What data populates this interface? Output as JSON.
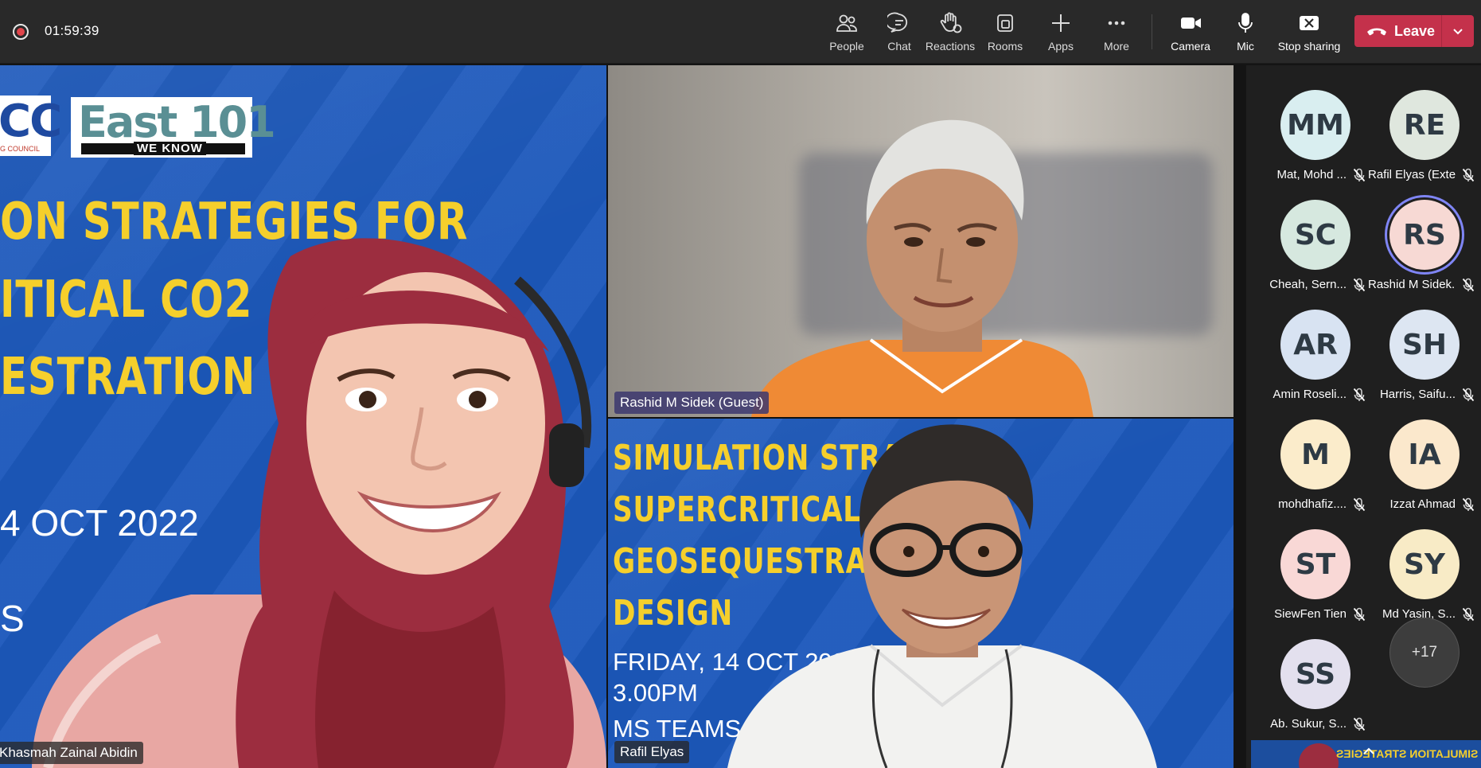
{
  "meeting": {
    "elapsed_time": "01:59:39"
  },
  "toolbar": {
    "people_label": "People",
    "chat_label": "Chat",
    "reactions_label": "Reactions",
    "rooms_label": "Rooms",
    "apps_label": "Apps",
    "more_label": "More",
    "camera_label": "Camera",
    "mic_label": "Mic",
    "stop_sharing_label": "Stop sharing",
    "leave_label": "Leave"
  },
  "video_tiles": [
    {
      "name_tag": "Khasmah Zainal Abidin",
      "slide": {
        "logo_left": "CC",
        "logo_left_small": "G COUNCIL",
        "logo_main": "East 101",
        "logo_sub": "WE KNOW",
        "line1": "ON STRATEGIES FOR",
        "line2": "ITICAL CO2",
        "line3": "ESTRATION COMP",
        "date": "4 OCT 2022",
        "platform": "S"
      }
    },
    {
      "name_tag": "Rashid M Sidek (Guest)"
    },
    {
      "name_tag": "Rafil Elyas",
      "slide": {
        "line1": "SIMULATION STRATEG",
        "line2": "SUPERCRITICAL CO2",
        "line3": "GEOSEQUESTRATION C",
        "line4": "DESIGN",
        "date": "FRIDAY, 14 OCT 2022",
        "time": "3.00PM",
        "platform": "MS TEAMS"
      }
    }
  ],
  "participants": [
    {
      "initials": "MM",
      "name": "Mat, Mohd ...",
      "color": "#d9eef0"
    },
    {
      "initials": "RE",
      "name": "Rafil Elyas (Exte...",
      "color": "#dfe7de"
    },
    {
      "initials": "SC",
      "name": "Cheah, Sern...",
      "color": "#d6e8df"
    },
    {
      "initials": "RS",
      "name": "Rashid M Sidek...",
      "color": "#f7d9d4"
    },
    {
      "initials": "AR",
      "name": "Amin Roseli...",
      "color": "#d8e3f2"
    },
    {
      "initials": "SH",
      "name": "Harris, Saifu...",
      "color": "#dde6f2"
    },
    {
      "initials": "M",
      "name": "mohdhafiz....",
      "color": "#fbeccb"
    },
    {
      "initials": "IA",
      "name": "Izzat Ahmad",
      "color": "#fbe8cc"
    },
    {
      "initials": "ST",
      "name": "SiewFen Tien",
      "color": "#f9d8d6"
    },
    {
      "initials": "SY",
      "name": "Md Yasin, S...",
      "color": "#f8ebc6"
    },
    {
      "initials": "SS",
      "name": "Ab. Sukur, S...",
      "color": "#e3e0ee"
    }
  ],
  "overflow": {
    "count_label": "+17"
  },
  "thumbnail": {
    "mirrored_text": "SIMULATION STRATEGIES"
  },
  "colors": {
    "leave_button": "#c4314b",
    "slide_blue": "#1c58bb",
    "slide_yellow": "#f5cf2c",
    "speaker_ring": "#7f85f5"
  }
}
